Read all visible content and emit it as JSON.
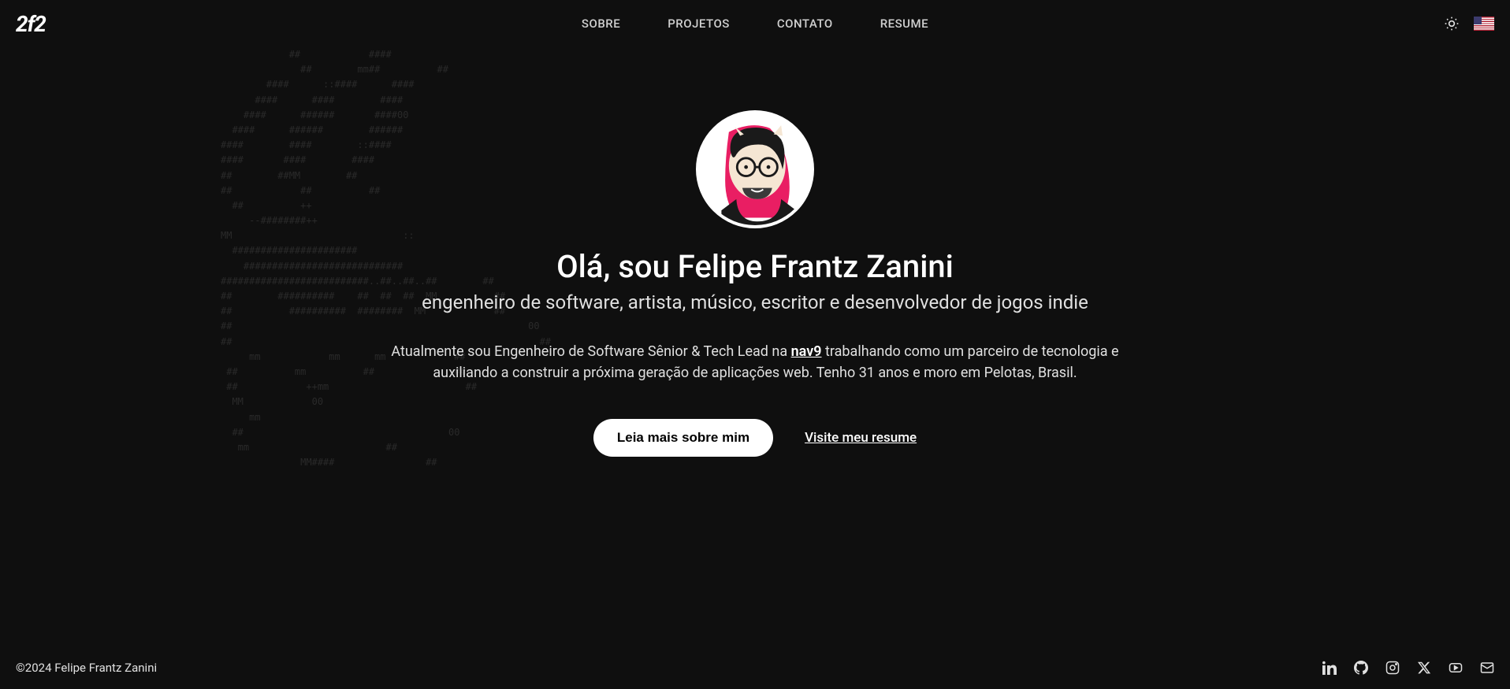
{
  "logo": "2f2",
  "nav": {
    "sobre": "SOBRE",
    "projetos": "PROJETOS",
    "contato": "CONTATO",
    "resume": "RESUME"
  },
  "hero": {
    "title": "Olá, sou Felipe Frantz Zanini",
    "subtitle": "engenheiro de software, artista, músico, escritor e desenvolvedor de jogos indie",
    "bio_pre": "Atualmente sou Engenheiro de Software Sênior & Tech Lead na ",
    "bio_link": "nav9",
    "bio_post": " trabalhando como um parceiro de tecnologia e auxiliando a construir a próxima geração de aplicações web. Tenho 31 anos e moro em Pelotas, Brasil.",
    "cta_primary": "Leia mais sobre mim",
    "cta_secondary": "Visite meu resume"
  },
  "footer": {
    "copyright": "©2024 Felipe Frantz Zanini"
  },
  "ascii": "            ##            ####\n              ##        mm##          ##\n        ####      ::####      ####\n      ####      ####        ####\n    ####      ######       ####00\n  ####      ######        ######\n####        ####        ::####\n####       ####        ####\n##        ##MM        ##\n##            ##          ##\n  ##          ++\n     --########++\nMM                              ::\n  ######################\n    ############################\n##########################..##..##..##        ##\n##        ##########    ##  ##  ##  MM          ##\n##          ##########  ########  MM            ##\n##                                                    00\n##                                                      ##\n     mm            mm      mm            ##\n ##          mm          ##              ##\n ##            ++mm                        ##\n  MM            00\n     mm\n  ##                                    00\n   mm                        ##\n              MM####                ##"
}
